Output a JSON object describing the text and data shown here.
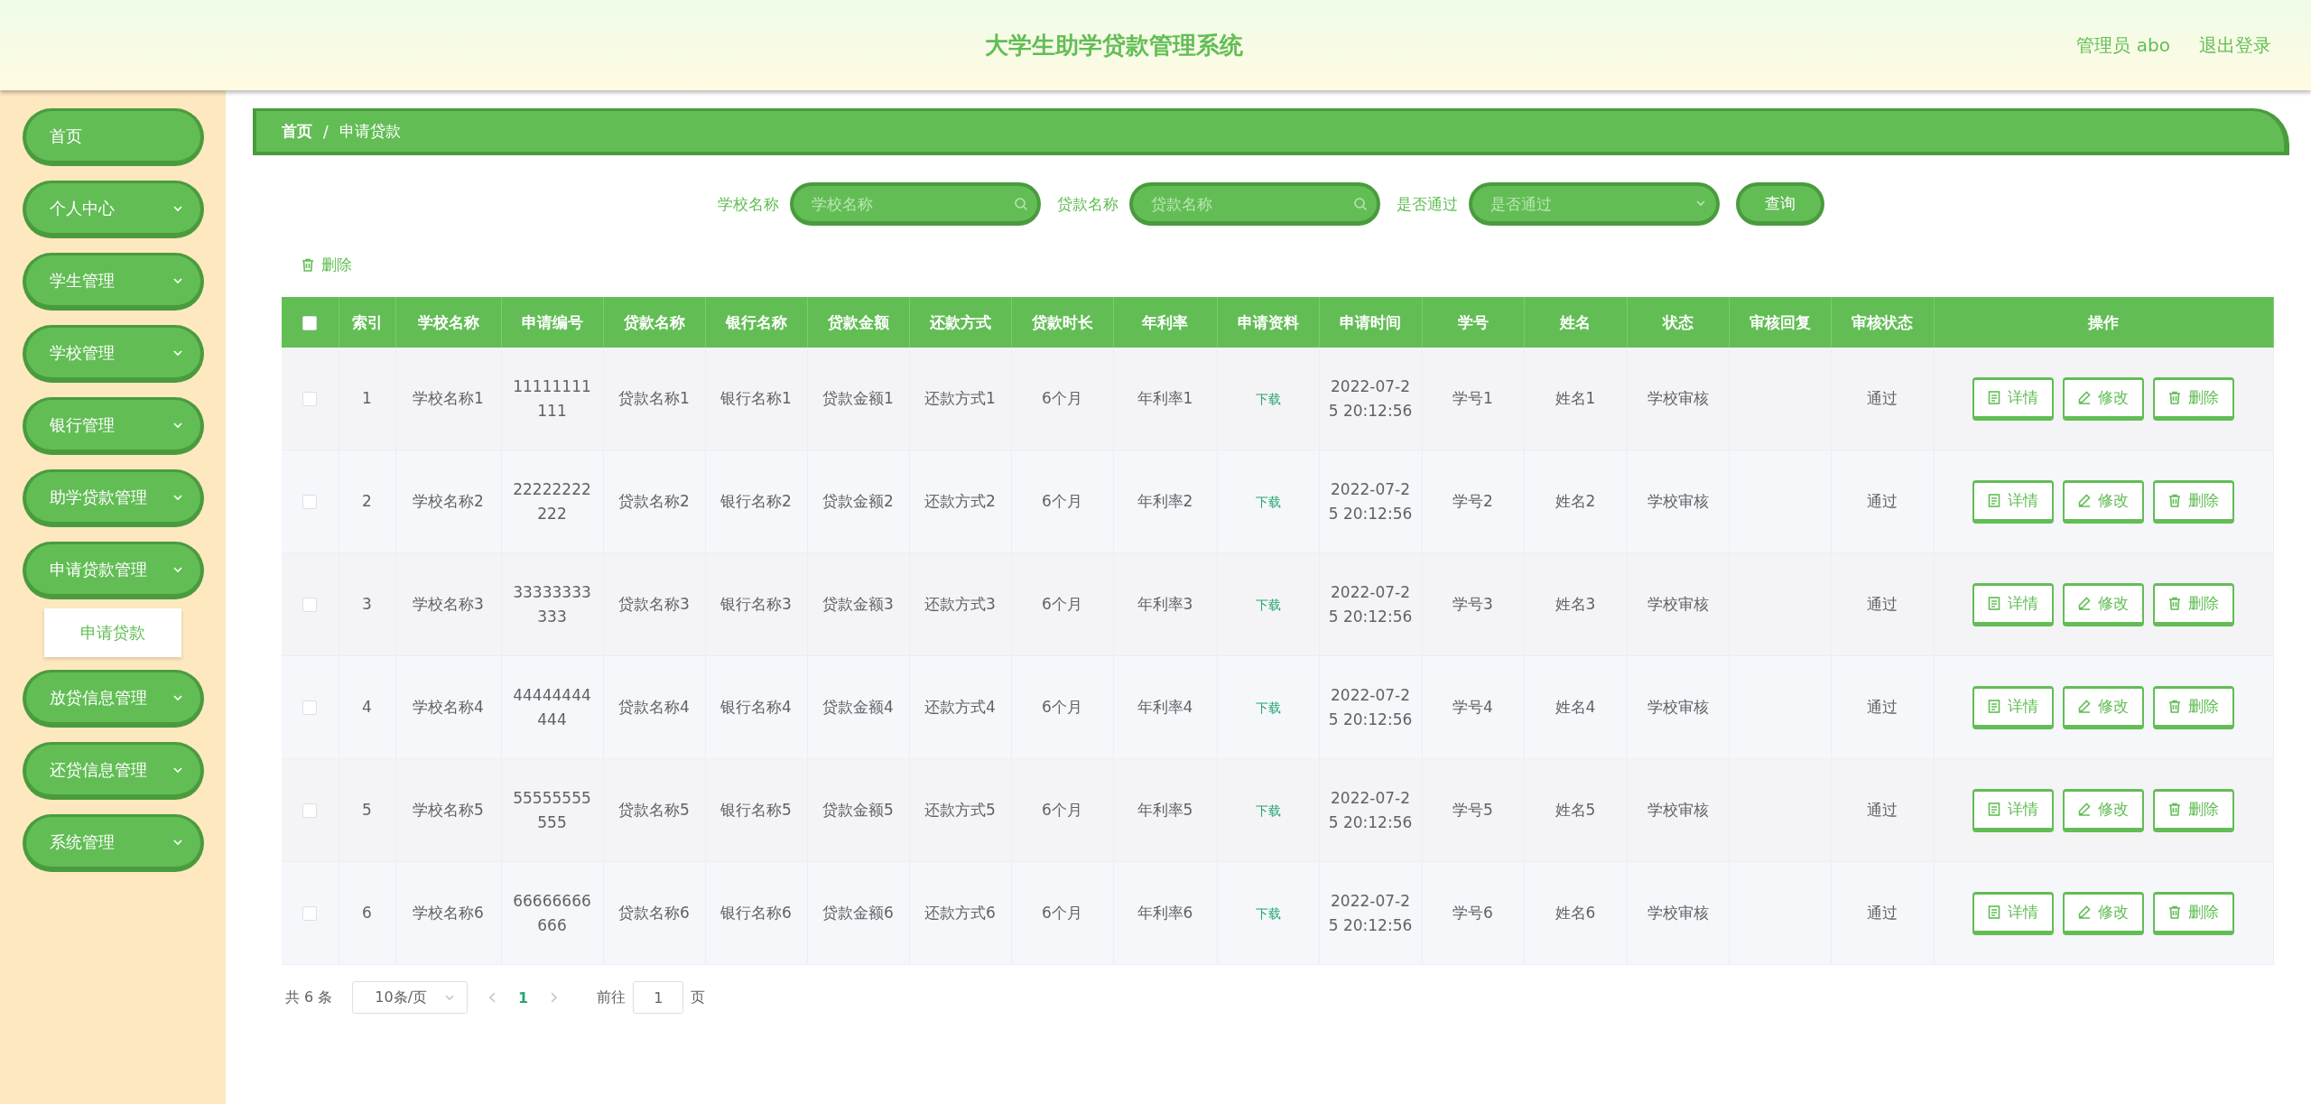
{
  "header": {
    "title": "大学生助学贷款管理系统",
    "user": "管理员 abo",
    "logout": "退出登录"
  },
  "sidebar": {
    "items": [
      {
        "label": "首页",
        "expandable": false
      },
      {
        "label": "个人中心",
        "expandable": true
      },
      {
        "label": "学生管理",
        "expandable": true
      },
      {
        "label": "学校管理",
        "expandable": true
      },
      {
        "label": "银行管理",
        "expandable": true
      },
      {
        "label": "助学贷款管理",
        "expandable": true
      },
      {
        "label": "申请贷款管理",
        "expandable": true,
        "children": [
          {
            "label": "申请贷款",
            "selected": true
          }
        ]
      },
      {
        "label": "放贷信息管理",
        "expandable": true
      },
      {
        "label": "还贷信息管理",
        "expandable": true
      },
      {
        "label": "系统管理",
        "expandable": true
      }
    ]
  },
  "breadcrumb": {
    "items": [
      "首页",
      "申请贷款"
    ],
    "separator": "/"
  },
  "search": {
    "fields": [
      {
        "kind": "input",
        "label": "学校名称",
        "placeholder": "学校名称"
      },
      {
        "kind": "input",
        "label": "贷款名称",
        "placeholder": "贷款名称"
      },
      {
        "kind": "select",
        "label": "是否通过",
        "placeholder": "是否通过"
      }
    ],
    "button": "查询"
  },
  "toolbar": {
    "delete": "删除"
  },
  "table": {
    "select_all": false,
    "columns": [
      "索引",
      "学校名称",
      "申请编号",
      "贷款名称",
      "银行名称",
      "贷款金额",
      "还款方式",
      "贷款时长",
      "年利率",
      "申请资料",
      "申请时间",
      "学号",
      "姓名",
      "状态",
      "审核回复",
      "审核状态",
      "操作"
    ],
    "rows": [
      {
        "selected": false,
        "cells": [
          "1",
          "学校名称1",
          "11111111111",
          "贷款名称1",
          "银行名称1",
          "贷款金额1",
          "还款方式1",
          "6个月",
          "年利率1",
          {
            "kind": "link",
            "text": "下载"
          },
          "2022-07-25 20:12:56",
          "学号1",
          "姓名1",
          "学校审核",
          null,
          "通过",
          [
            "详情",
            "修改",
            "删除"
          ]
        ]
      },
      {
        "selected": false,
        "cells": [
          "2",
          "学校名称2",
          "22222222222",
          "贷款名称2",
          "银行名称2",
          "贷款金额2",
          "还款方式2",
          "6个月",
          "年利率2",
          {
            "kind": "link",
            "text": "下载"
          },
          "2022-07-25 20:12:56",
          "学号2",
          "姓名2",
          "学校审核",
          null,
          "通过",
          [
            "详情",
            "修改",
            "删除"
          ]
        ]
      },
      {
        "selected": false,
        "cells": [
          "3",
          "学校名称3",
          "33333333333",
          "贷款名称3",
          "银行名称3",
          "贷款金额3",
          "还款方式3",
          "6个月",
          "年利率3",
          {
            "kind": "link",
            "text": "下载"
          },
          "2022-07-25 20:12:56",
          "学号3",
          "姓名3",
          "学校审核",
          null,
          "通过",
          [
            "详情",
            "修改",
            "删除"
          ]
        ]
      },
      {
        "selected": false,
        "cells": [
          "4",
          "学校名称4",
          "44444444444",
          "贷款名称4",
          "银行名称4",
          "贷款金额4",
          "还款方式4",
          "6个月",
          "年利率4",
          {
            "kind": "link",
            "text": "下载"
          },
          "2022-07-25 20:12:56",
          "学号4",
          "姓名4",
          "学校审核",
          null,
          "通过",
          [
            "详情",
            "修改",
            "删除"
          ]
        ]
      },
      {
        "selected": false,
        "cells": [
          "5",
          "学校名称5",
          "55555555555",
          "贷款名称5",
          "银行名称5",
          "贷款金额5",
          "还款方式5",
          "6个月",
          "年利率5",
          {
            "kind": "link",
            "text": "下载"
          },
          "2022-07-25 20:12:56",
          "学号5",
          "姓名5",
          "学校审核",
          null,
          "通过",
          [
            "详情",
            "修改",
            "删除"
          ]
        ]
      },
      {
        "selected": false,
        "cells": [
          "6",
          "学校名称6",
          "66666666666",
          "贷款名称6",
          "银行名称6",
          "贷款金额6",
          "还款方式6",
          "6个月",
          "年利率6",
          {
            "kind": "link",
            "text": "下载"
          },
          "2022-07-25 20:12:56",
          "学号6",
          "姓名6",
          "学校审核",
          null,
          "通过",
          [
            "详情",
            "修改",
            "删除"
          ]
        ]
      }
    ]
  },
  "pager": {
    "total": "共 6 条",
    "page_size": "10条/页",
    "pages": [
      {
        "label": "1",
        "selected": true
      }
    ],
    "goto_label": "前往",
    "goto_value": "1",
    "goto_suffix": "页"
  }
}
